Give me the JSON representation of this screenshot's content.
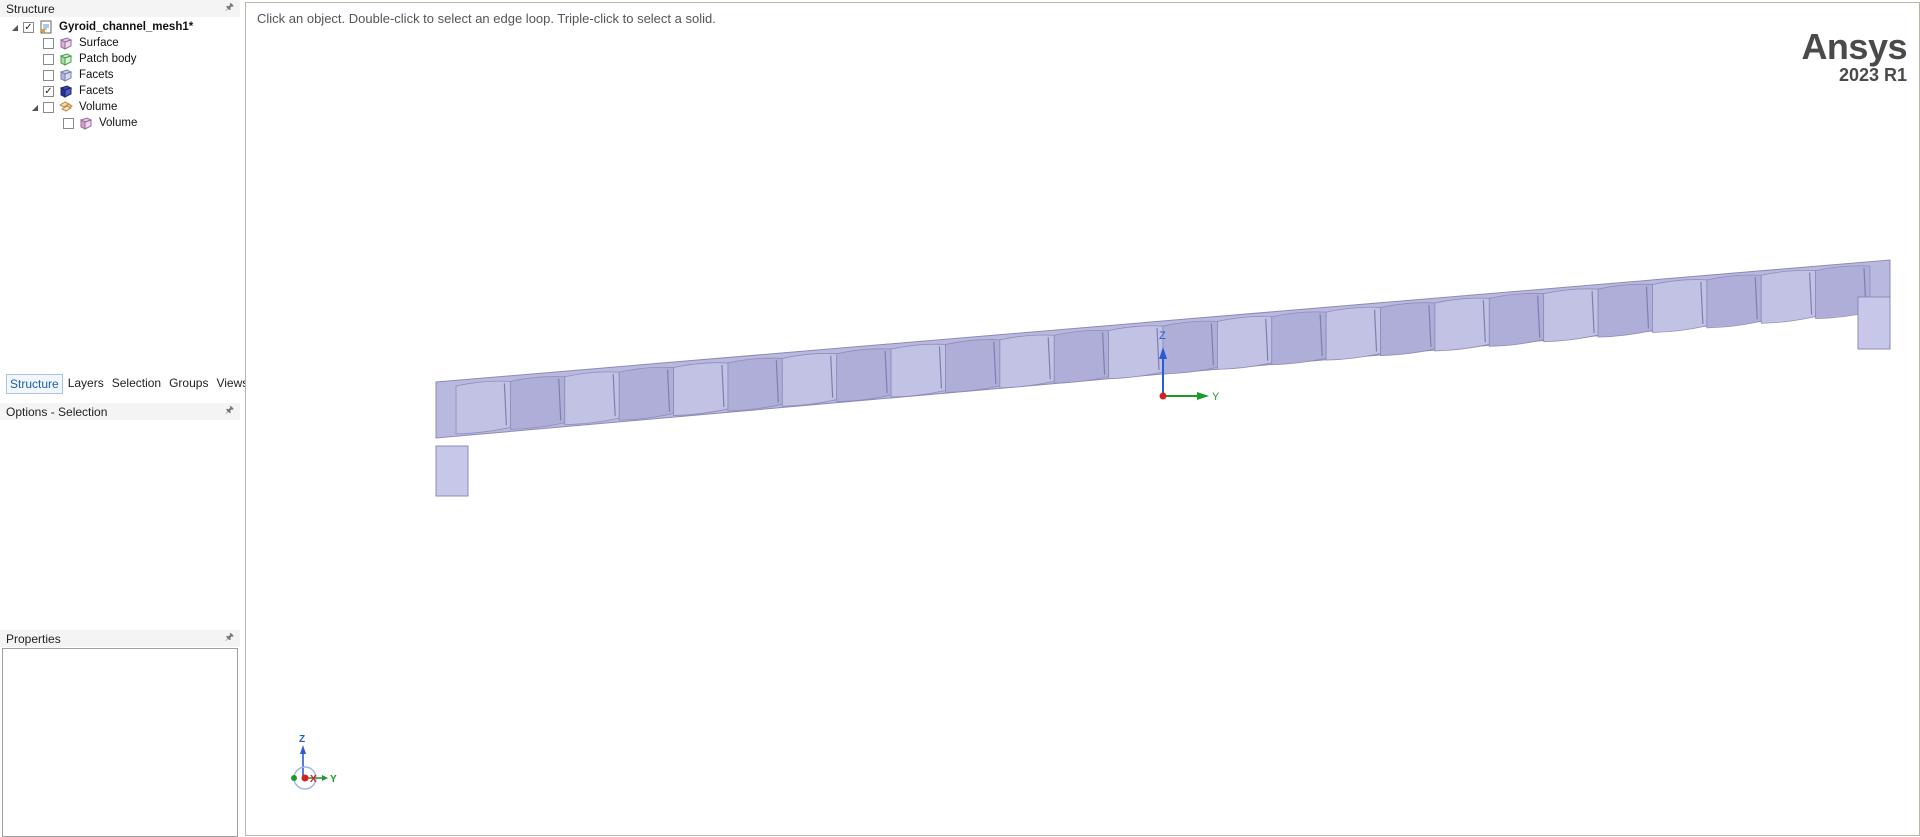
{
  "structure": {
    "header": "Structure",
    "tree": [
      {
        "label": "Gyroid_channel_mesh1*",
        "checked": true,
        "expander": "expanded",
        "icon": "design-doc-icon"
      },
      {
        "label": "Surface",
        "checked": false,
        "expander": "none",
        "icon": "surface-body-icon"
      },
      {
        "label": "Patch body",
        "checked": false,
        "expander": "none",
        "icon": "patch-body-icon"
      },
      {
        "label": "Facets",
        "checked": false,
        "expander": "none",
        "icon": "facets-body-icon"
      },
      {
        "label": "Facets",
        "checked": true,
        "expander": "none",
        "icon": "facets-body-dark-icon"
      },
      {
        "label": "Volume",
        "checked": false,
        "expander": "expanded",
        "icon": "volume-component-icon"
      },
      {
        "label": "Volume",
        "checked": false,
        "expander": "none",
        "icon": "volume-body-icon"
      }
    ]
  },
  "tabs": [
    "Structure",
    "Layers",
    "Selection",
    "Groups",
    "Views"
  ],
  "active_tab": "Structure",
  "options": {
    "header": "Options - Selection"
  },
  "properties": {
    "header": "Properties"
  },
  "viewport": {
    "hint": "Click an object. Double-click to select an edge loop. Triple-click to select a solid.",
    "logo": {
      "brand": "Ansys",
      "version": "2023 R1"
    },
    "axes": {
      "z": "Z",
      "y": "Y",
      "x": "X"
    },
    "colors": {
      "body": "#b9b9e0",
      "body_edge": "#8b8bb8",
      "axis_z": "#2a5bd7",
      "axis_y": "#1d9a2a",
      "axis_x": "#d62020"
    }
  }
}
